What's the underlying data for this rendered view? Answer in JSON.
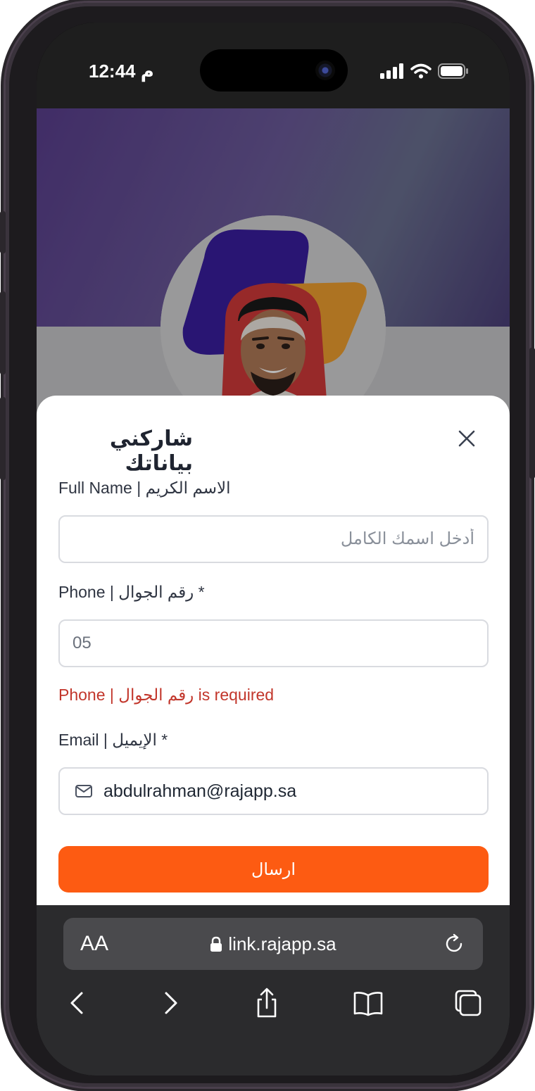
{
  "status_bar": {
    "time": "12:44 م"
  },
  "modal": {
    "title": "شاركني بياناتك",
    "full_name": {
      "label": "Full Name | الاسم الكريم",
      "placeholder": "أدخل اسمك الكامل"
    },
    "phone": {
      "label": "Phone | رقم الجوال *",
      "value": "05",
      "error": "Phone | رقم الجوال is required"
    },
    "email": {
      "label": "Email | الإيميل *",
      "value": "abdulrahman@rajapp.sa"
    },
    "submit_label": "ارسال"
  },
  "browser": {
    "text_size_label": "AA",
    "url": "link.rajapp.sa"
  },
  "colors": {
    "accent": "#fd5b12",
    "error": "#c2362b",
    "header_purple": "#5a3f8e"
  }
}
